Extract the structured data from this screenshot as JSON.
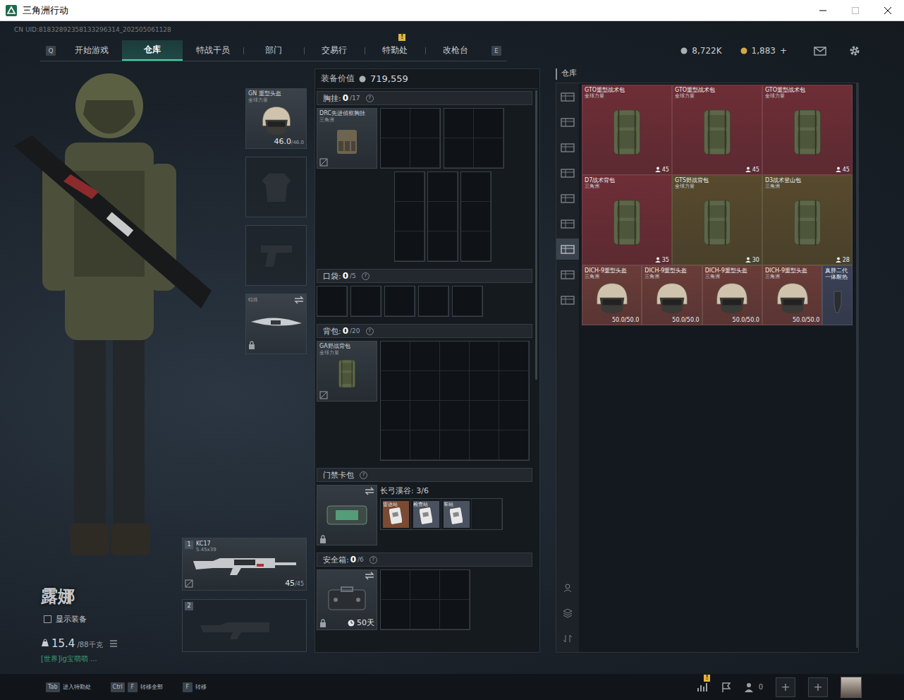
{
  "window": {
    "title": "三角洲行动"
  },
  "uid": "CN UID:81832892358133296314_202505061128",
  "nav": {
    "keys": [
      "Q",
      "E"
    ],
    "tabs": [
      {
        "label": "开始游戏",
        "selected": false
      },
      {
        "label": "仓库",
        "selected": true
      },
      {
        "label": "特战干员",
        "selected": false
      },
      {
        "label": "部门",
        "selected": false
      },
      {
        "label": "交易行",
        "selected": false
      },
      {
        "label": "特勤处",
        "selected": false,
        "badge": "!"
      },
      {
        "label": "改枪台",
        "selected": false
      }
    ]
  },
  "currency": {
    "coins": "8,722K",
    "tickets": "1,883",
    "add": "+"
  },
  "character": {
    "name": "露娜",
    "show_gear": {
      "label": "显示装备",
      "checked": false
    },
    "weight": "15.4",
    "weight_max": "/88千克",
    "chat": "[世界]ig宝萌萌 ..."
  },
  "gear": {
    "helmet": {
      "name": "GN 重型头盔",
      "faction": "全球力量",
      "durability": "46.0",
      "durability_max": "/46.0"
    },
    "melee": {
      "label": "特殊",
      "locked": true
    }
  },
  "weapons": [
    {
      "slot": "1",
      "name": "KC17",
      "caliber": "5.45x39",
      "ammo": "45",
      "ammo_max": "/45"
    },
    {
      "slot": "2"
    }
  ],
  "loadout": {
    "value_label": "装备价值",
    "value": "719,559",
    "chest": {
      "label": "胸挂:",
      "count": "0",
      "capacity": "/17",
      "help": "?",
      "item": {
        "name": "DRC先进侦察胸挂",
        "faction": "三角洲"
      }
    },
    "pockets": {
      "label": "口袋:",
      "count": "0",
      "capacity": "/5",
      "help": "?"
    },
    "backpack": {
      "label": "背包:",
      "count": "0",
      "capacity": "/20",
      "help": "?",
      "item": {
        "name": "GA野战背包",
        "faction": "全球力量"
      }
    },
    "keycards": {
      "label": "门禁卡包",
      "help": "?",
      "map": "长弓溪谷: 3/6",
      "cards": [
        {
          "name": "雷达站",
          "color": "#7a4a32"
        },
        {
          "name": "检查站",
          "color": "#4a5260"
        },
        {
          "name": "车站",
          "color": "#4a5260"
        }
      ]
    },
    "safe": {
      "label": "安全箱:",
      "count": "0",
      "capacity": "/6",
      "help": "?",
      "days": "50天"
    }
  },
  "stash": {
    "title": "仓库",
    "sidebar": [
      {
        "selected": false
      },
      {
        "selected": false
      },
      {
        "selected": false
      },
      {
        "selected": false
      },
      {
        "selected": false
      },
      {
        "selected": false
      },
      {
        "selected": true
      },
      {
        "selected": false
      },
      {
        "selected": false
      }
    ],
    "items": [
      {
        "name": "GTO重型战术包",
        "faction": "全球力量",
        "value": "45",
        "kind": "backpack",
        "color": "#6e2e36"
      },
      {
        "name": "GTO重型战术包",
        "faction": "全球力量",
        "value": "45",
        "kind": "backpack",
        "color": "#6e2e36"
      },
      {
        "name": "GTO重型战术包",
        "faction": "全球力量",
        "value": "45",
        "kind": "backpack",
        "color": "#6e2e36"
      },
      {
        "name": "D7战术背包",
        "faction": "三角洲",
        "value": "35",
        "kind": "backpack",
        "color": "#6e2e36"
      },
      {
        "name": "GTS野战背包",
        "faction": "全球力量",
        "value": "30",
        "kind": "backpack",
        "color": "#574a2d"
      },
      {
        "name": "D3战术登山包",
        "faction": "三角洲",
        "value": "28",
        "kind": "backpack",
        "color": "#574a2d"
      },
      {
        "name": "DICH-9重型头盔",
        "faction": "三角洲",
        "value": "50.0/50.0",
        "kind": "helmet",
        "color": "#6a3c38"
      },
      {
        "name": "DICH-9重型头盔",
        "faction": "三角洲",
        "value": "50.0/50.0",
        "kind": "helmet",
        "color": "#6a3c38"
      },
      {
        "name": "DICH-9重型头盔",
        "faction": "三角洲",
        "value": "50.0/50.0",
        "kind": "helmet",
        "color": "#6a3c38"
      },
      {
        "name": "DICH-9重型头盔",
        "faction": "三角洲",
        "value": "50.0/50.0",
        "kind": "helmet",
        "color": "#6a3c38"
      },
      {
        "name": "真胖二代一体耐热",
        "kind": "holster",
        "color": "#3b4156"
      }
    ]
  },
  "bottom_bar": {
    "hints": [
      {
        "keys": [
          "Tab"
        ],
        "label": "进入特勤处"
      },
      {
        "keys": [
          "Ctrl",
          "F"
        ],
        "label": "转移全部"
      },
      {
        "keys": [
          "F"
        ],
        "label": "转移"
      }
    ],
    "stats_badge": "!",
    "friends": "0",
    "add_buttons": [
      "+",
      "+"
    ]
  }
}
